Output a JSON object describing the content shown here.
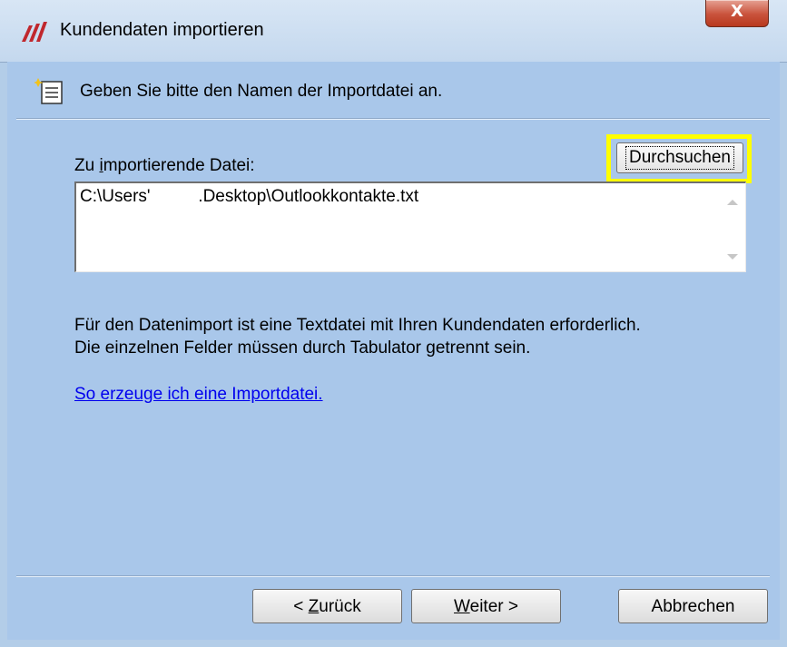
{
  "window": {
    "title": "Kundendaten importieren",
    "close_symbol": "X",
    "app_icon": "app-logo-icon",
    "colors": {
      "background": "#a9c7ea",
      "titlebar": "#c4d8ee",
      "close": "#c9523b",
      "highlight": "#ffff00",
      "link": "#0000ee"
    }
  },
  "header": {
    "icon": "wizard-document-icon",
    "text": "Geben Sie bitte den Namen der Importdatei an."
  },
  "form": {
    "label_prefix": "Zu ",
    "label_accel": "i",
    "label_suffix": "mportierende Datei:",
    "browse_label": "Durchsuchen",
    "file_path": "C:\\Users'          .Desktop\\Outlookkontakte.txt"
  },
  "info": {
    "line1": "Für den Datenimport ist eine Textdatei mit Ihren Kundendaten erforderlich.",
    "line2": "Die einzelnen Felder müssen durch Tabulator getrennt sein."
  },
  "help_link": "So erzeuge ich eine Importdatei.",
  "footer": {
    "back_prefix": "< ",
    "back_accel": "Z",
    "back_suffix": "urück",
    "next_accel": "W",
    "next_suffix": "eiter >",
    "cancel_label": "Abbrechen"
  }
}
